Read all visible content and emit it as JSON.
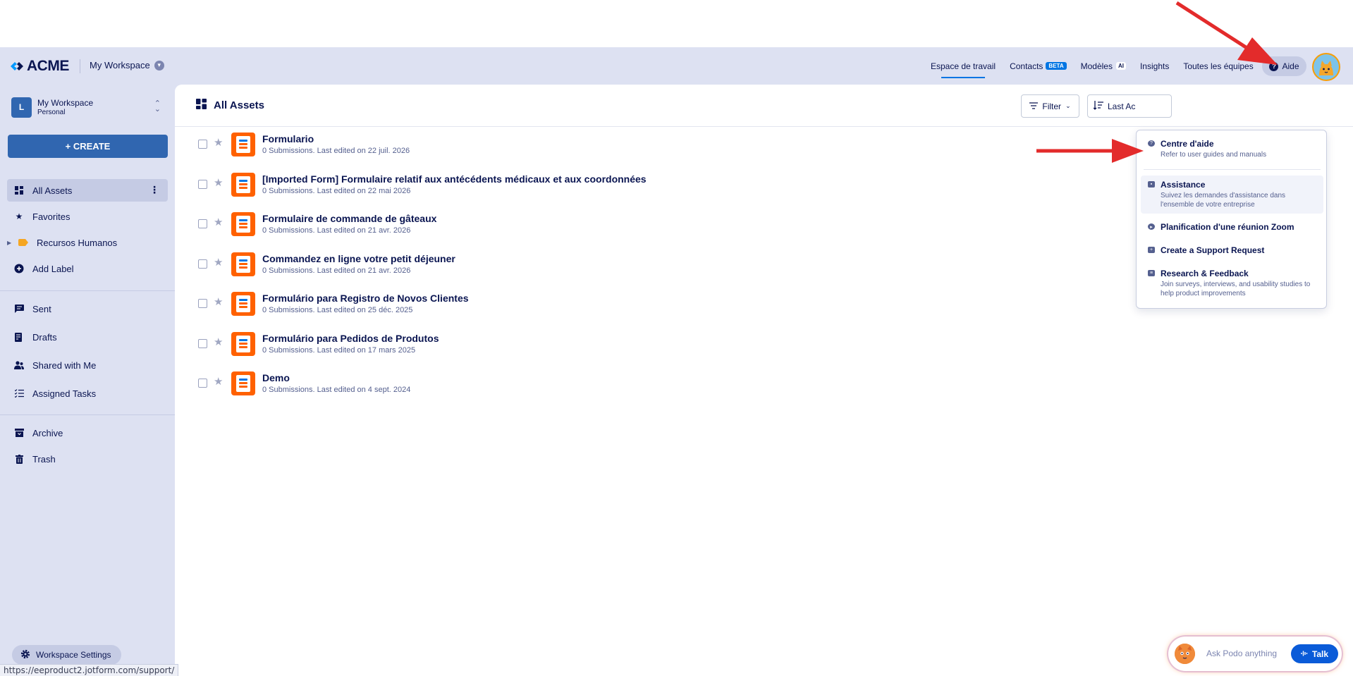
{
  "header": {
    "logo_text": "ACME",
    "workspace": "My Workspace",
    "nav": [
      {
        "label": "Espace de travail",
        "active": true
      },
      {
        "label": "Contacts",
        "badge": "BETA"
      },
      {
        "label": "Modèles",
        "badge": "AI"
      },
      {
        "label": "Insights"
      },
      {
        "label": "Toutes les équipes"
      }
    ],
    "help_label": "Aide"
  },
  "sidebar": {
    "ws_initial": "L",
    "ws_name": "My Workspace",
    "ws_sub": "Personal",
    "create_label": "+ CREATE",
    "items_top": [
      {
        "label": "All Assets",
        "icon": "grid-icon"
      },
      {
        "label": "Favorites",
        "icon": "star-icon"
      },
      {
        "label": "Recursos Humanos",
        "icon": "label-icon"
      },
      {
        "label": "Add Label",
        "icon": "plus-circle-icon"
      }
    ],
    "items_mid": [
      {
        "label": "Sent",
        "icon": "sent-icon"
      },
      {
        "label": "Drafts",
        "icon": "drafts-icon"
      },
      {
        "label": "Shared with Me",
        "icon": "shared-icon"
      },
      {
        "label": "Assigned Tasks",
        "icon": "tasks-icon"
      }
    ],
    "items_bottom": [
      {
        "label": "Archive",
        "icon": "archive-icon"
      },
      {
        "label": "Trash",
        "icon": "trash-icon"
      }
    ],
    "settings_label": "Workspace Settings"
  },
  "main": {
    "title": "All Assets",
    "filter_label": "Filter",
    "sort_label": "Last Ac",
    "assets": [
      {
        "name": "Formulario",
        "meta": "0 Submissions. Last edited on 22 juil. 2026"
      },
      {
        "name": "[Imported Form] Formulaire relatif aux antécédents médicaux et aux coordonnées",
        "meta": "0 Submissions. Last edited on 22 mai 2026"
      },
      {
        "name": "Formulaire de commande de gâteaux",
        "meta": "0 Submissions. Last edited on 21 avr. 2026"
      },
      {
        "name": "Commandez en ligne votre petit déjeuner",
        "meta": "0 Submissions. Last edited on 21 avr. 2026"
      },
      {
        "name": "Formulário para Registro de Novos Clientes",
        "meta": "0 Submissions. Last edited on 25 déc. 2025"
      },
      {
        "name": "Formulário para Pedidos de Produtos",
        "meta": "0 Submissions. Last edited on 17 mars 2025"
      },
      {
        "name": "Demo",
        "meta": "0 Submissions. Last edited on 4 sept. 2024"
      }
    ]
  },
  "help_menu": {
    "items": [
      {
        "title": "Centre d'aide",
        "desc": "Refer to user guides and manuals"
      },
      {
        "title": "Assistance",
        "desc": "Suivez les demandes d'assistance dans l'ensemble de votre entreprise"
      },
      {
        "title": "Planification d'une réunion Zoom",
        "desc": ""
      },
      {
        "title": "Create a Support Request",
        "desc": ""
      },
      {
        "title": "Research & Feedback",
        "desc": "Join surveys, interviews, and usability studies to help product improvements"
      }
    ]
  },
  "podo": {
    "placeholder": "Ask Podo anything",
    "talk_label": "Talk"
  },
  "status_url": "https://eeproduct2.jotform.com/support/",
  "colors": {
    "brand": "#0a1551",
    "accent": "#0075e3",
    "create": "#3066b0",
    "form_icon": "#ff6100",
    "arrow": "#e32b2b"
  }
}
